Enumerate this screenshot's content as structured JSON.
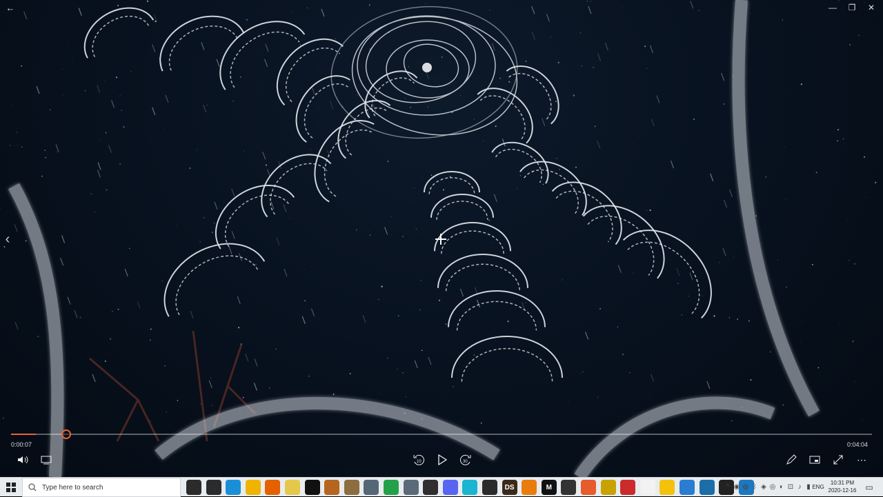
{
  "window": {
    "back_icon": "back-arrow-icon",
    "minimize_label": "—",
    "restore_label": "❐",
    "close_label": "✕"
  },
  "player": {
    "current_time": "0:00:07",
    "total_time": "0:04:04",
    "progress": 0.029,
    "accent_color": "#e8643c",
    "icons": {
      "volume": "volume-icon",
      "subtitles": "subtitles-icon",
      "rewind": "rewind-10-icon",
      "play": "play-icon",
      "forward": "forward-30-icon",
      "edit": "pencil-icon",
      "mini_view": "mini-view-icon",
      "fullscreen": "fullscreen-icon",
      "more": "more-icon",
      "previous": "chevron-left-icon"
    }
  },
  "taskbar": {
    "search_placeholder": "Type here to search",
    "clock_time": "10:31 PM",
    "clock_date": "2020-12-16",
    "language": "ENG",
    "apps": [
      {
        "name": "cortana-icon",
        "label": "",
        "color": "#2b2b2b"
      },
      {
        "name": "task-view-icon",
        "label": "",
        "color": "#2b2b2b"
      },
      {
        "name": "edge-icon",
        "label": "",
        "color": "#1a8fd6"
      },
      {
        "name": "file-explorer-icon",
        "label": "",
        "color": "#f0b400"
      },
      {
        "name": "firefox-icon",
        "label": "",
        "color": "#e66000"
      },
      {
        "name": "app-yellow-icon",
        "label": "",
        "color": "#e5c84a"
      },
      {
        "name": "oculus-icon",
        "label": "",
        "color": "#111111"
      },
      {
        "name": "app-brush-icon",
        "label": "",
        "color": "#b5651d"
      },
      {
        "name": "app-globe-icon",
        "label": "",
        "color": "#8c6d3f"
      },
      {
        "name": "app-fish-icon",
        "label": "",
        "color": "#556677"
      },
      {
        "name": "maps-icon",
        "label": "",
        "color": "#24a148"
      },
      {
        "name": "app-rhombus-icon",
        "label": "",
        "color": "#5b6a78"
      },
      {
        "name": "obs-icon",
        "label": "",
        "color": "#302e31"
      },
      {
        "name": "discord-icon",
        "label": "",
        "color": "#5865f2"
      },
      {
        "name": "app-cyan-icon",
        "label": "",
        "color": "#19b5d1"
      },
      {
        "name": "app-phone-icon",
        "label": "",
        "color": "#2b2b2b"
      },
      {
        "name": "daz-studio-icon",
        "label": "DS",
        "color": "#3b2a1a"
      },
      {
        "name": "blender-icon",
        "label": "",
        "color": "#e87d0d"
      },
      {
        "name": "app-m-icon",
        "label": "M",
        "color": "#111111"
      },
      {
        "name": "app-kitty-icon",
        "label": "",
        "color": "#333333"
      },
      {
        "name": "app-orange-box-icon",
        "label": "",
        "color": "#e65c2a"
      },
      {
        "name": "app-triangle-icon",
        "label": "",
        "color": "#c8a200"
      },
      {
        "name": "app-red-s-icon",
        "label": "",
        "color": "#cc2b2b"
      },
      {
        "name": "notepad-icon",
        "label": "",
        "color": "#f2f2f2"
      },
      {
        "name": "app-sun-icon",
        "label": "",
        "color": "#f4c20d"
      },
      {
        "name": "app-blue-doc-icon",
        "label": "",
        "color": "#2b7cd3"
      },
      {
        "name": "app-monitor-icon",
        "label": "",
        "color": "#1b6ea8"
      },
      {
        "name": "app-dark-icon",
        "label": "",
        "color": "#222222"
      },
      {
        "name": "movies-tv-icon",
        "label": "",
        "color": "#1c78c0"
      }
    ],
    "tray_icons": [
      "chevron-up-icon",
      "tray-app-icon",
      "tray-app2-icon",
      "bluetooth-icon",
      "tray-app3-icon",
      "tray-app4-icon",
      "tray-app5-icon",
      "network-icon",
      "volume-tray-icon",
      "battery-icon"
    ]
  }
}
